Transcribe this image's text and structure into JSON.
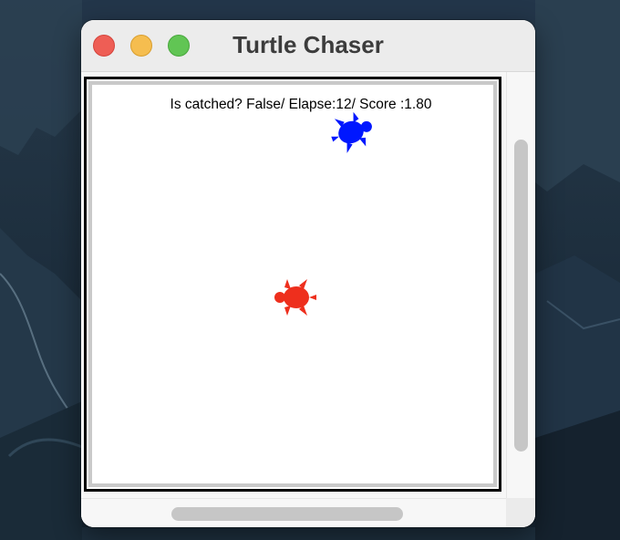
{
  "window": {
    "title": "Turtle Chaser"
  },
  "canvas": {
    "status_text": "Is catched? False/ Elapse:12/ Score :1.80",
    "turtles": [
      {
        "name": "chaser-turtle",
        "color": "#0017ff",
        "heading_deg": -20
      },
      {
        "name": "target-turtle",
        "color": "#ee2f1d",
        "heading_deg": 180
      }
    ]
  },
  "colors": {
    "close": "#ee5e55",
    "minimize": "#f5bd4f",
    "zoom": "#61c554"
  }
}
